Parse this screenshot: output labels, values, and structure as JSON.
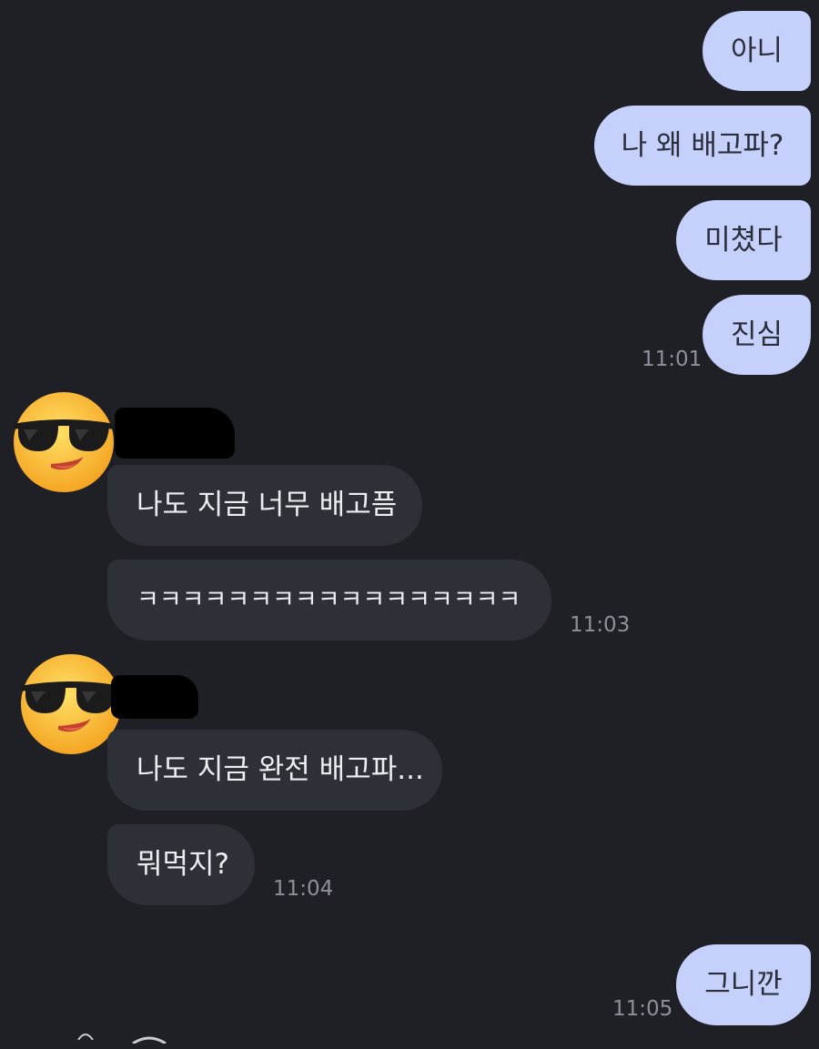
{
  "messages": {
    "sent_group1": [
      "아니",
      "나 왜 배고파?",
      "미쳤다",
      "진심"
    ],
    "sent_group1_time": "11:01",
    "recv_group1": [
      "나도 지금 너무 배고픔",
      "ㅋㅋㅋㅋㅋㅋㅋㅋㅋㅋㅋㅋㅋㅋㅋㅋㅋ"
    ],
    "recv_group1_time": "11:03",
    "recv_group2": [
      "나도 지금 완전 배고파...",
      "뭐먹지?"
    ],
    "recv_group2_time": "11:04",
    "sent_group2": [
      "그니깐"
    ],
    "sent_group2_time": "11:05"
  },
  "avatar": {
    "icon": "sunglasses-smiley-icon"
  },
  "colors": {
    "background": "#1e2026",
    "sent_bubble": "#c5d1fa",
    "received_bubble": "#2e3037",
    "timestamp": "#8d919b"
  }
}
